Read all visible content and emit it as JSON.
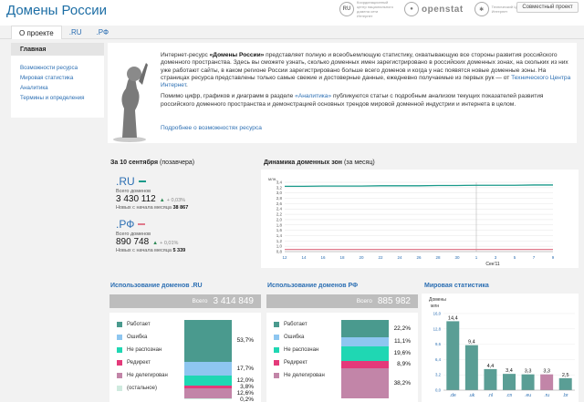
{
  "header": {
    "title": "Домены России",
    "partners": [
      {
        "mark": "RU",
        "text": "Координационный центр национального домена сети Интернет"
      },
      {
        "mark": "",
        "text": "openstat"
      },
      {
        "mark": "TCI",
        "text": "Технический Центр Интернет"
      }
    ],
    "joint_label": "Совместный проект"
  },
  "tabs": [
    {
      "label": "О проекте",
      "active": true
    },
    {
      "label": ".RU",
      "active": false
    },
    {
      "label": ".РФ",
      "active": false
    }
  ],
  "sidebar": {
    "heading": "Главная",
    "items": [
      {
        "label": "Возможности ресурса"
      },
      {
        "label": "Мировая статистика"
      },
      {
        "label": "Аналитика"
      },
      {
        "label": "Термины и определения"
      }
    ]
  },
  "intro": {
    "p1_a": "Интернет-ресурс",
    "p1_b": "«Домены России»",
    "p1_c": "представляет полную и всеобъемлющую статистику, охватывающую все стороны развития российского доменного пространства. Здесь вы сможете узнать, сколько доменных имен зарегистрировано в российских доменных зонах, на скольких из них уже работают сайты, в каком регионе России зарегистрировано больше всего доменов и когда у нас появятся новые доменные зоны. На страницах ресурса представлены только самые свежие и достоверные данные, ежедневно получаемые из первых рук — от",
    "p1_link": "Технического Центра Интернет",
    "p1_end": ".",
    "p2_a": "Помимо цифр, графиков и диаграмм в разделе",
    "p2_link": "«Аналитика»",
    "p2_b": "публикуются статьи с подробным анализом текущих показателей развития российского доменного пространства и демонстрацией основных трендов мировой доменной индустрии и интернета в целом.",
    "more": "Подробнее о возможностях ресурса"
  },
  "stats": {
    "date_bold": "За 10 сентября",
    "date_rest": "(позавчера)",
    "total_caption": "Всего доменов",
    "new_caption": "Новых с начала месяца",
    "zones": [
      {
        "name": ".RU",
        "color": "#1a9a8a",
        "total": "3 430 112",
        "delta": "+ 0,03%",
        "new": "38 867"
      },
      {
        "name": ".РФ",
        "color": "#e07a8c",
        "total": "890 748",
        "delta": "+ 0,01%",
        "new": "5 339"
      }
    ]
  },
  "dynamics": {
    "title_bold": "Динамика доменных зон",
    "title_rest": "(за месяц)",
    "unit": "млн.",
    "month_label": "Сен'11"
  },
  "usage_ru": {
    "title": "Использование доменов .RU",
    "total_label": "Всего",
    "total_value": "3 414 849"
  },
  "usage_rf": {
    "title": "Использование доменов РФ",
    "total_label": "Всего",
    "total_value": "885 982"
  },
  "usage_legend": [
    {
      "label": "Работает",
      "color": "#4a9a8e"
    },
    {
      "label": "Ошибка",
      "color": "#8ec6f0"
    },
    {
      "label": "Не распознан",
      "color": "#1fd7b3"
    },
    {
      "label": "Редирект",
      "color": "#e43a7a"
    },
    {
      "label": "Не делегирован",
      "color": "#c285a8"
    },
    {
      "label": "(остальное)",
      "color": "#cfeadf"
    }
  ],
  "world": {
    "title": "Мировая статистика",
    "ylabel_top": "Домены",
    "ylabel_unit": "млн"
  },
  "chart_data": [
    {
      "type": "line",
      "name": "dynamics",
      "x_ticks": [
        "12",
        "14",
        "16",
        "18",
        "20",
        "22",
        "24",
        "26",
        "28",
        "30",
        "1",
        "3",
        "5",
        "7",
        "9"
      ],
      "y_ticks": [
        "3,4",
        "3,2",
        "3,0",
        "2,8",
        "2,6",
        "2,4",
        "2,2",
        "2,0",
        "1,8",
        "1,6",
        "1,4",
        "1,2",
        "1,0",
        "0,8"
      ],
      "ylim": [
        0.8,
        3.4
      ],
      "series": [
        {
          "color": "#1a9a8a",
          "values": [
            3.25,
            3.25,
            3.26,
            3.26,
            3.26,
            3.27,
            3.27,
            3.27,
            3.28,
            3.28,
            3.29,
            3.29,
            3.29,
            3.3,
            3.3
          ]
        },
        {
          "color": "#e07a8c",
          "values": [
            0.88,
            0.88,
            0.88,
            0.88,
            0.88,
            0.88,
            0.88,
            0.88,
            0.88,
            0.88,
            0.88,
            0.88,
            0.88,
            0.88,
            0.88
          ]
        }
      ]
    },
    {
      "type": "bar",
      "name": "usage-ru",
      "categories": [
        "Работает",
        "Ошибка",
        "Не распознан",
        "Редирект",
        "Не делегирован",
        "(остальное)"
      ],
      "values": [
        53.7,
        17.7,
        12.0,
        3.8,
        12.6,
        0.2
      ],
      "labels": [
        "53,7%",
        "17,7%",
        "12,0%",
        "3,8%",
        "12,6%",
        "0,2%"
      ]
    },
    {
      "type": "bar",
      "name": "usage-rf",
      "categories": [
        "Работает",
        "Ошибка",
        "Не распознан",
        "Редирект",
        "Не делегирован"
      ],
      "values": [
        22.2,
        11.1,
        19.6,
        8.9,
        38.2
      ],
      "labels": [
        "22,2%",
        "11,1%",
        "19,6%",
        "8,9%",
        "38,2%"
      ]
    },
    {
      "type": "bar",
      "name": "world",
      "categories": [
        ".de",
        ".uk",
        ".nl",
        ".cn",
        ".eu",
        ".ru",
        ".br"
      ],
      "values": [
        14.4,
        9.4,
        4.4,
        3.4,
        3.3,
        3.3,
        2.5
      ],
      "labels": [
        "14,4",
        "9,4",
        "4,4",
        "3,4",
        "3,3",
        "3,3",
        "2,5"
      ],
      "highlight": ".ru",
      "y_ticks": [
        "16,0",
        "12,8",
        "9,6",
        "6,4",
        "3,2",
        "0,0"
      ],
      "ylim": [
        0,
        16
      ]
    }
  ]
}
